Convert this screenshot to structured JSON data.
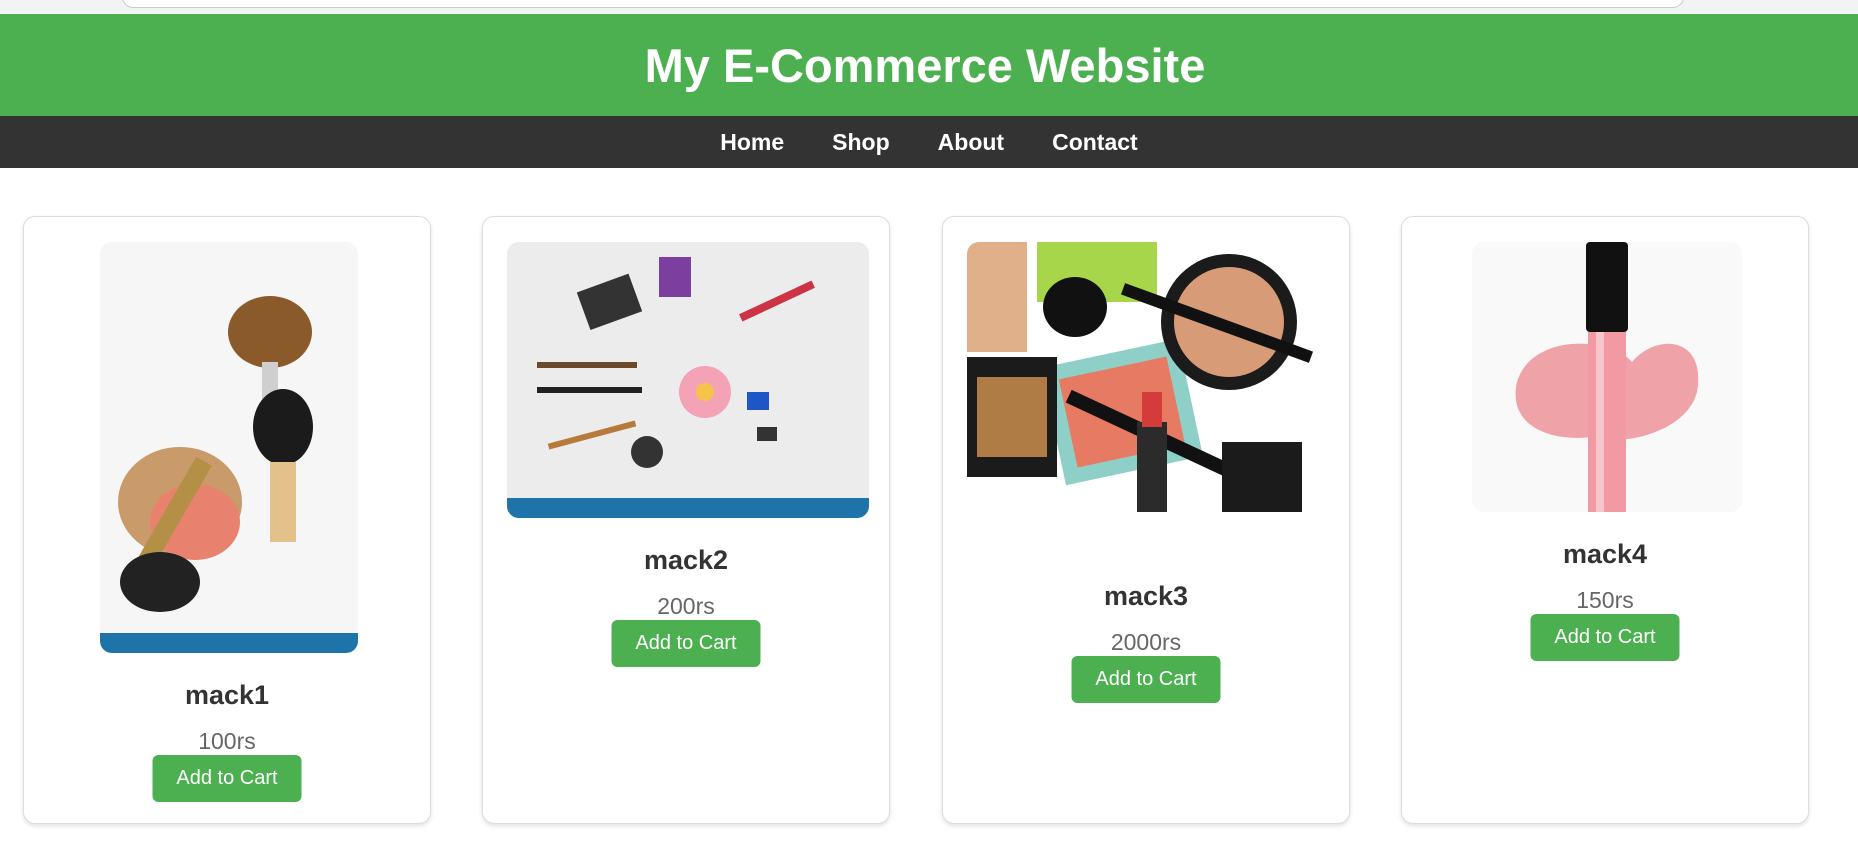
{
  "site": {
    "title": "My E-Commerce Website"
  },
  "nav": {
    "items": [
      {
        "label": "Home"
      },
      {
        "label": "Shop"
      },
      {
        "label": "About"
      },
      {
        "label": "Contact"
      }
    ]
  },
  "products": [
    {
      "name": "mack1",
      "price": "100rs",
      "button_label": "Add to Cart",
      "image": "makeup-brushes-and-blush-photo"
    },
    {
      "name": "mack2",
      "price": "200rs",
      "button_label": "Add to Cart",
      "image": "cosmetics-flatlay-with-flower-photo"
    },
    {
      "name": "mack3",
      "price": "2000rs",
      "button_label": "Add to Cart",
      "image": "mac-makeup-collection-photo"
    },
    {
      "name": "mack4",
      "price": "150rs",
      "button_label": "Add to Cart",
      "image": "pink-lip-gloss-photo"
    }
  ],
  "colors": {
    "header": "#4caf50",
    "nav": "#333333",
    "button": "#4caf50"
  }
}
